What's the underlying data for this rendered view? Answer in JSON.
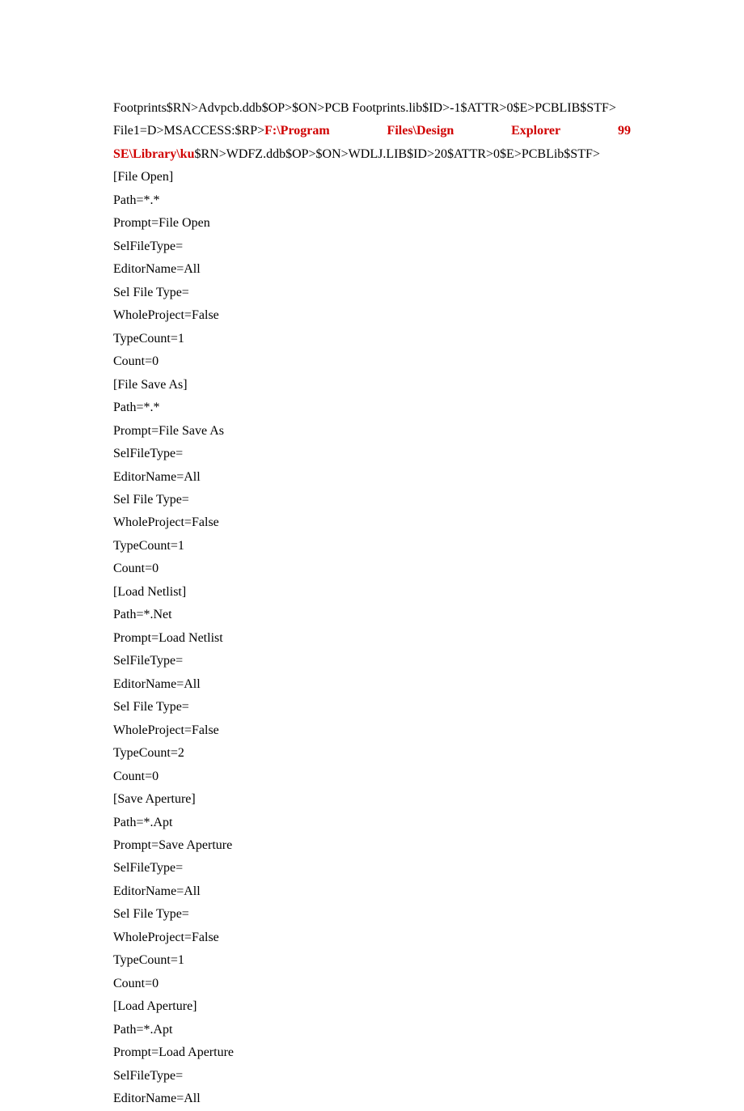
{
  "l00": "Footprints$RN>Advpcb.ddb$OP>$ON>PCB Footprints.lib$ID>-1$ATTR>0$E>PCBLIB$STF>",
  "l01_left": "File1=D>MSACCESS:$RP>",
  "l01_p1": "F:\\Program",
  "l01_p2": "Files\\Design",
  "l01_p3": "Explorer",
  "l01_p4": "99",
  "l02_red": "SE\\Library\\ku",
  "l02_rest": "$RN>WDFZ.ddb$OP>$ON>WDLJ.LIB$ID>20$ATTR>0$E>PCBLib$STF>",
  "l03": "[File Open]",
  "l04": "Path=*.*",
  "l05": "Prompt=File Open",
  "l06": "SelFileType=",
  "l07": "EditorName=All",
  "l08": "Sel File Type=",
  "l09": "WholeProject=False",
  "l10": "TypeCount=1",
  "l11": "Count=0",
  "l12": "[File Save As]",
  "l13": "Path=*.*",
  "l14": "Prompt=File Save As",
  "l15": "SelFileType=",
  "l16": "EditorName=All",
  "l17": "Sel File Type=",
  "l18": "WholeProject=False",
  "l19": "TypeCount=1",
  "l20": "Count=0",
  "l21": "[Load Netlist]",
  "l22": "Path=*.Net",
  "l23": "Prompt=Load Netlist",
  "l24": "SelFileType=",
  "l25": "EditorName=All",
  "l26": "Sel File Type=",
  "l27": "WholeProject=False",
  "l28": "TypeCount=2",
  "l29": "Count=0",
  "l30": "[Save Aperture]",
  "l31": "Path=*.Apt",
  "l32": "Prompt=Save Aperture",
  "l33": "SelFileType=",
  "l34": "EditorName=All",
  "l35": "Sel File Type=",
  "l36": "WholeProject=False",
  "l37": "TypeCount=1",
  "l38": "Count=0",
  "l39": "[Load Aperture]",
  "l40": "Path=*.Apt",
  "l41": "Prompt=Load Aperture",
  "l42": "SelFileType=",
  "l43": "EditorName=All"
}
